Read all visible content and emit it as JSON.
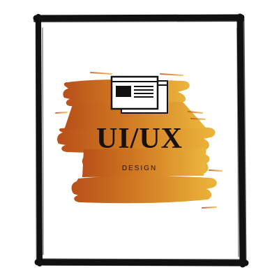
{
  "logo": {
    "title": "UI/UX",
    "subtitle": "DESIGN",
    "icon": "browser-window-icon"
  },
  "colors": {
    "frame": "#111111",
    "brush_left": "#b8501a",
    "brush_right": "#ebb63c",
    "text": "#1a1108",
    "background": "#ffffff"
  }
}
